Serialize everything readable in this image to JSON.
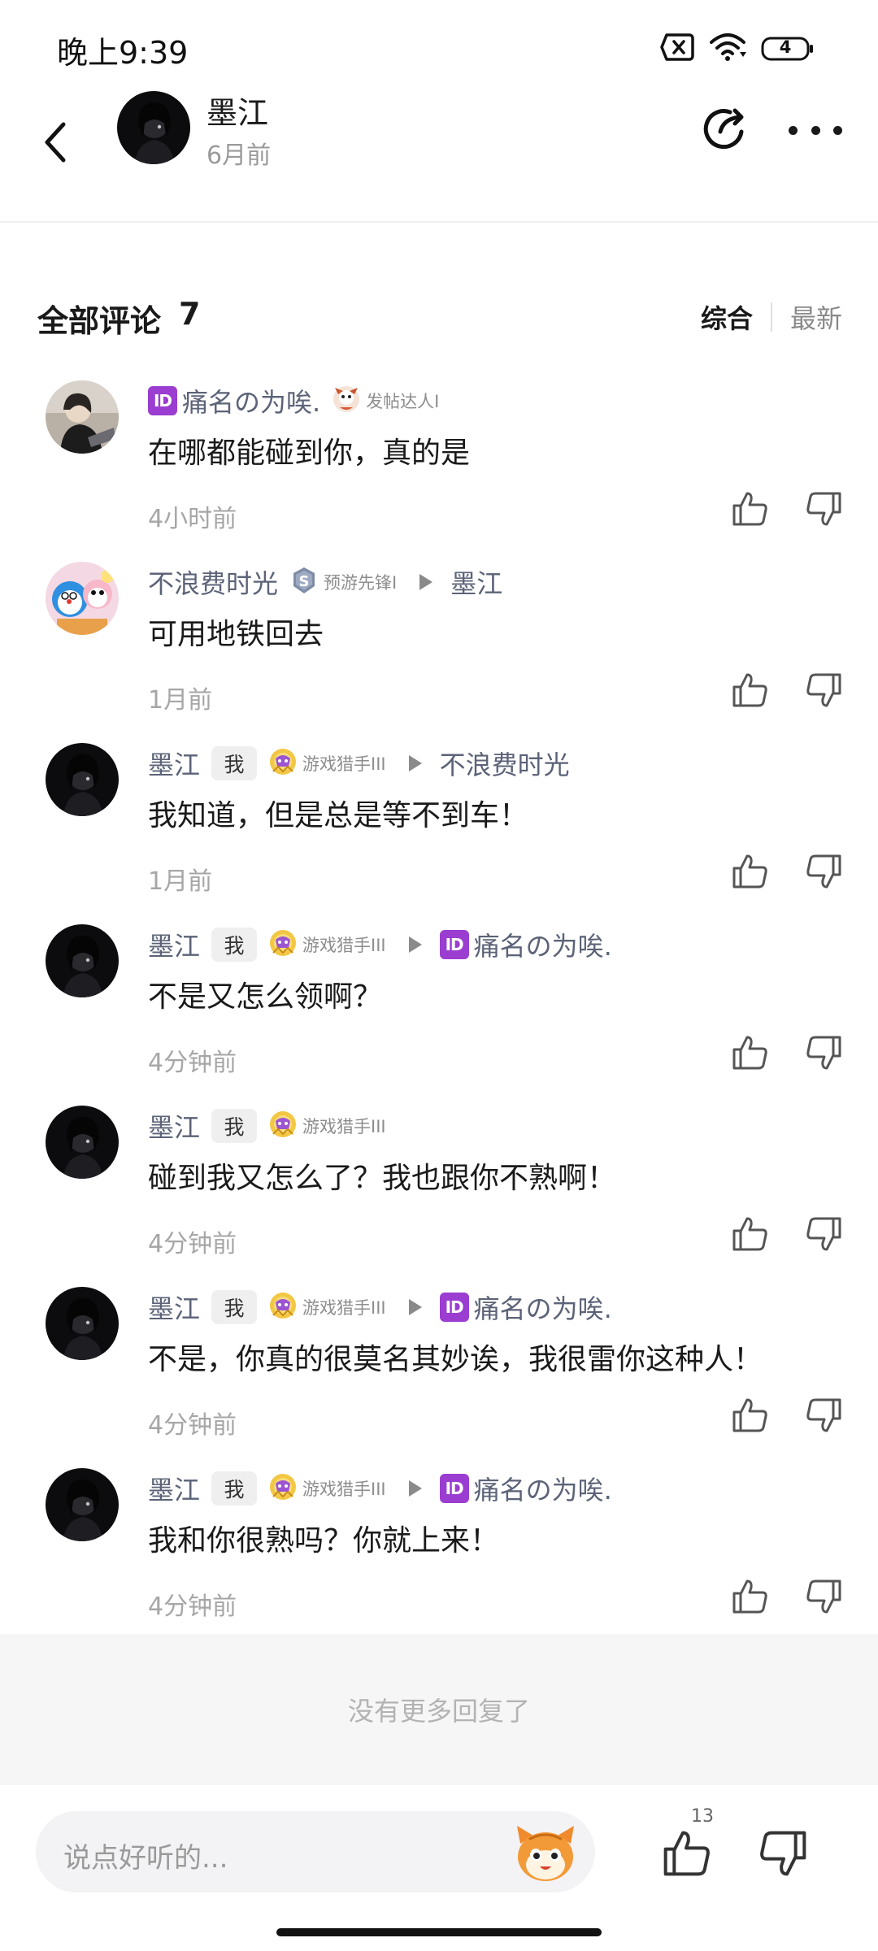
{
  "status_bar": {
    "time": "晚上9:39",
    "battery_level": "4",
    "icons": [
      "sim-error-icon",
      "wifi-icon",
      "battery-icon"
    ]
  },
  "header": {
    "name": "墨江",
    "time": "6月前",
    "icons": [
      "back-arrow-icon",
      "share-icon",
      "more-icon"
    ]
  },
  "comments_header": {
    "title": "全部评论",
    "count": "7",
    "sort_tabs": [
      "综合",
      "最新"
    ],
    "active_sort": "综合"
  },
  "comments": [
    {
      "avatar": "user-photo-avatar",
      "name": "痛名の为唉.",
      "name_id_badge": "ID",
      "badge": "",
      "medal": "发帖达人I",
      "reply_to": "",
      "reply_to_id_badge": "",
      "text": "在哪都能碰到你，真的是",
      "time": "4小时前"
    },
    {
      "avatar": "cartoon-avatar",
      "name": "不浪费时光",
      "name_id_badge": "",
      "badge": "",
      "medal": "预游先锋I",
      "reply_to": "墨江",
      "reply_to_id_badge": "",
      "text": "可用地铁回去",
      "time": "1月前"
    },
    {
      "avatar": "dark-avatar",
      "name": "墨江",
      "name_id_badge": "",
      "badge": "我",
      "medal": "游戏猎手III",
      "reply_to": "不浪费时光",
      "reply_to_id_badge": "",
      "text": "我知道，但是总是等不到车！",
      "time": "1月前"
    },
    {
      "avatar": "dark-avatar",
      "name": "墨江",
      "name_id_badge": "",
      "badge": "我",
      "medal": "游戏猎手III",
      "reply_to": "痛名の为唉.",
      "reply_to_id_badge": "ID",
      "text": "不是又怎么领啊？",
      "time": "4分钟前"
    },
    {
      "avatar": "dark-avatar",
      "name": "墨江",
      "name_id_badge": "",
      "badge": "我",
      "medal": "游戏猎手III",
      "reply_to": "",
      "reply_to_id_badge": "",
      "text": "碰到我又怎么了？我也跟你不熟啊！",
      "time": "4分钟前"
    },
    {
      "avatar": "dark-avatar",
      "name": "墨江",
      "name_id_badge": "",
      "badge": "我",
      "medal": "游戏猎手III",
      "reply_to": "痛名の为唉.",
      "reply_to_id_badge": "ID",
      "text": "不是，你真的很莫名其妙诶，我很雷你这种人！",
      "time": "4分钟前"
    },
    {
      "avatar": "dark-avatar",
      "name": "墨江",
      "name_id_badge": "",
      "badge": "我",
      "medal": "游戏猎手III",
      "reply_to": "痛名の为唉.",
      "reply_to_id_badge": "ID",
      "text": "我和你很熟吗？你就上来！",
      "time": "4分钟前"
    }
  ],
  "no_more_text": "没有更多回复了",
  "bottom_bar": {
    "placeholder": "说点好听的...",
    "like_count": "13"
  },
  "colors": {
    "name": "#5c6378",
    "time": "#a6a6a6",
    "id_badge": "#9b3dd1",
    "divider": "#efefef",
    "no_more_bg": "#f6f6f7"
  }
}
